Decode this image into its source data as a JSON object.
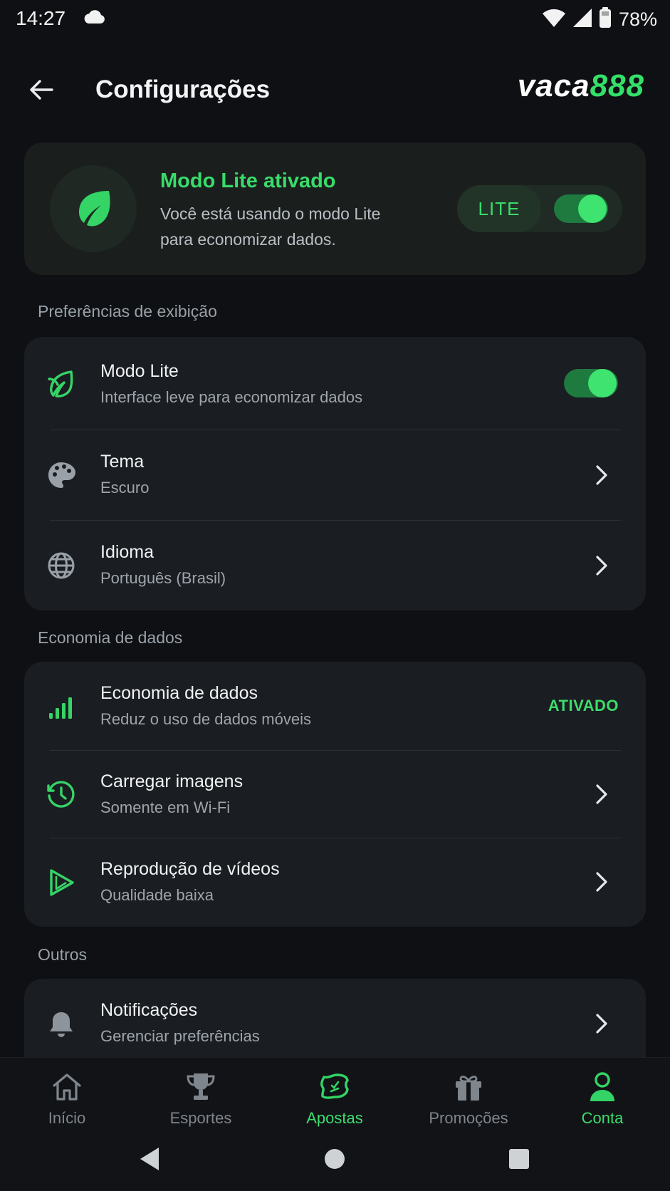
{
  "status_bar": {
    "time": "14:27",
    "battery": "78%",
    "icons": [
      "cloud-icon",
      "wifi-icon",
      "signal-icon",
      "battery-icon"
    ]
  },
  "header": {
    "title": "Configurações",
    "brand_part1": "vaca",
    "brand_part2": "888",
    "back_icon": "arrow-left-icon"
  },
  "lite_banner": {
    "title": "Modo Lite ativado",
    "description": "Você está usando o modo Lite para economizar dados.",
    "pill_label": "LITE",
    "toggle_on": true,
    "icon": "leaf-icon"
  },
  "sections": {
    "display_label": "Preferências de exibição",
    "data_label": "Economia de dados",
    "others_label": "Outros"
  },
  "display_rows": [
    {
      "title": "Modo Lite",
      "subtitle": "Interface leve para economizar dados",
      "icon": "lite-mode-icon",
      "control": "toggle",
      "toggle_on": true
    },
    {
      "title": "Tema",
      "subtitle": "Escuro",
      "icon": "palette-icon",
      "control": "chevron"
    },
    {
      "title": "Idioma",
      "subtitle": "Português (Brasil)",
      "icon": "globe-icon",
      "control": "chevron"
    }
  ],
  "data_rows": [
    {
      "title": "Economia de dados",
      "subtitle": "Reduz o uso de dados móveis",
      "icon": "signal-bars-icon",
      "control": "status",
      "status": "ATIVADO"
    },
    {
      "title": "Carregar imagens",
      "subtitle": "Somente em Wi-Fi",
      "icon": "clock-icon",
      "control": "chevron"
    },
    {
      "title": "Reprodução de vídeos",
      "subtitle": "Qualidade baixa",
      "icon": "play-icon",
      "control": "chevron"
    }
  ],
  "other_rows": [
    {
      "title": "Notificações",
      "subtitle": "Gerenciar preferências",
      "icon": "bell-icon",
      "control": "chevron"
    }
  ],
  "bottom_nav": [
    {
      "label": "Início",
      "icon": "home-icon",
      "active": false
    },
    {
      "label": "Esportes",
      "icon": "trophy-icon",
      "active": false
    },
    {
      "label": "Apostas",
      "icon": "ticket-icon",
      "active": true
    },
    {
      "label": "Promoções",
      "icon": "gift-icon",
      "active": false
    },
    {
      "label": "Conta",
      "icon": "user-icon",
      "active": true
    }
  ],
  "colors": {
    "accent": "#3ddc6c",
    "background": "#0e1013",
    "card": "#1a1d21"
  }
}
